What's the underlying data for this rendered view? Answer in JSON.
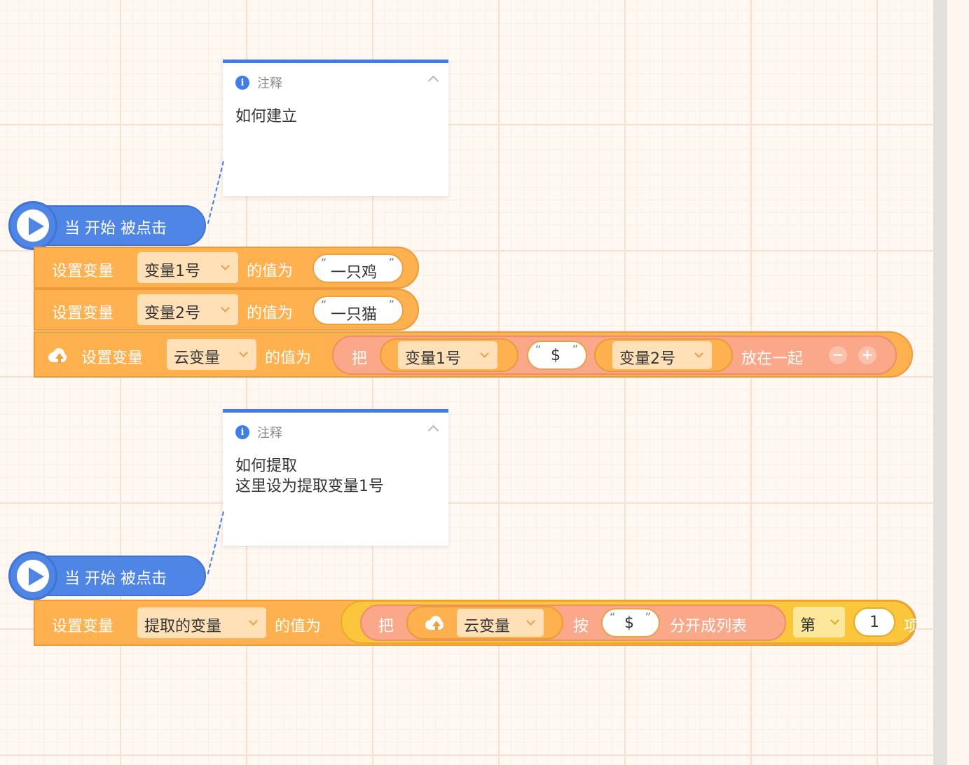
{
  "comments": [
    {
      "title": "注释",
      "body_lines": [
        "如何建立"
      ]
    },
    {
      "title": "注释",
      "body_lines": [
        "如何提取",
        "这里设为提取变量1号"
      ]
    }
  ],
  "scripts": [
    {
      "hat_label": "当 开始 被点击",
      "set_blocks": [
        {
          "label": "设置变量",
          "variable": "变量1号",
          "value_label": "的值为",
          "value": "一只鸡"
        },
        {
          "label": "设置变量",
          "variable": "变量2号",
          "value_label": "的值为",
          "value": "一只猫"
        }
      ],
      "cloud_block": {
        "label": "设置变量",
        "variable": "云变量",
        "value_label": "的值为",
        "join": {
          "prefix": "把",
          "item1": "变量1号",
          "separator": "$",
          "item2": "变量2号",
          "suffix": "放在一起",
          "minus": "−",
          "plus": "+"
        }
      }
    },
    {
      "hat_label": "当 开始 被点击",
      "set_block": {
        "label": "设置变量",
        "variable": "提取的变量",
        "value_label": "的值为",
        "item": {
          "prefix": "把",
          "cloud_variable": "云变量",
          "by_label": "按",
          "separator": "$",
          "split_label": "分开成列表",
          "ordinal": "第",
          "index": "1",
          "item_label": "项"
        }
      }
    }
  ],
  "colors": {
    "event": "#4f86e6",
    "variable": "#ffb14f",
    "operator": "#fba789",
    "list": "#f9c63c",
    "comment_accent": "#3f7ee8"
  }
}
